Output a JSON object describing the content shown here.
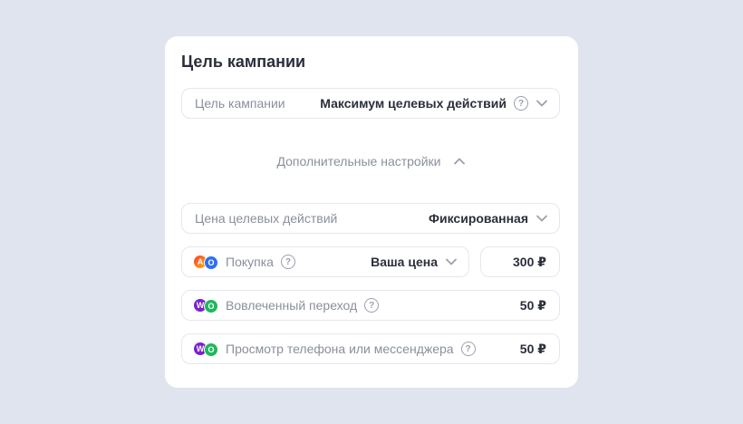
{
  "card_title": "Цель кампании",
  "goal_row": {
    "label": "Цель кампании",
    "value": "Максимум целевых действий",
    "help_icon": "?"
  },
  "advanced": {
    "label": "Дополнительные настройки"
  },
  "price_row": {
    "label": "Цена целевых действий",
    "value": "Фиксированная"
  },
  "purchase_row": {
    "label": "Покупка",
    "help_icon": "?",
    "mode": "Ваша цена",
    "amount": "300 ₽",
    "logo_left": "A",
    "logo_right": "O"
  },
  "engaged_row": {
    "label": "Вовлеченный переход",
    "help_icon": "?",
    "amount": "50 ₽",
    "logo_left": "W",
    "logo_right": "O"
  },
  "phone_row": {
    "label": "Просмотр телефона или мессенджера",
    "help_icon": "?",
    "amount": "50 ₽",
    "logo_left": "W",
    "logo_right": "O"
  },
  "colors": {
    "background": "#dfe4ee",
    "card": "#ffffff",
    "border": "#e4e7ee",
    "muted_text": "#8a8f9c",
    "main_text": "#2b2f3a"
  },
  "icons": [
    "question-circle-icon",
    "chevron-down-icon",
    "chevron-up-icon",
    "metrika-logo-icon",
    "ads-logo-icon"
  ]
}
